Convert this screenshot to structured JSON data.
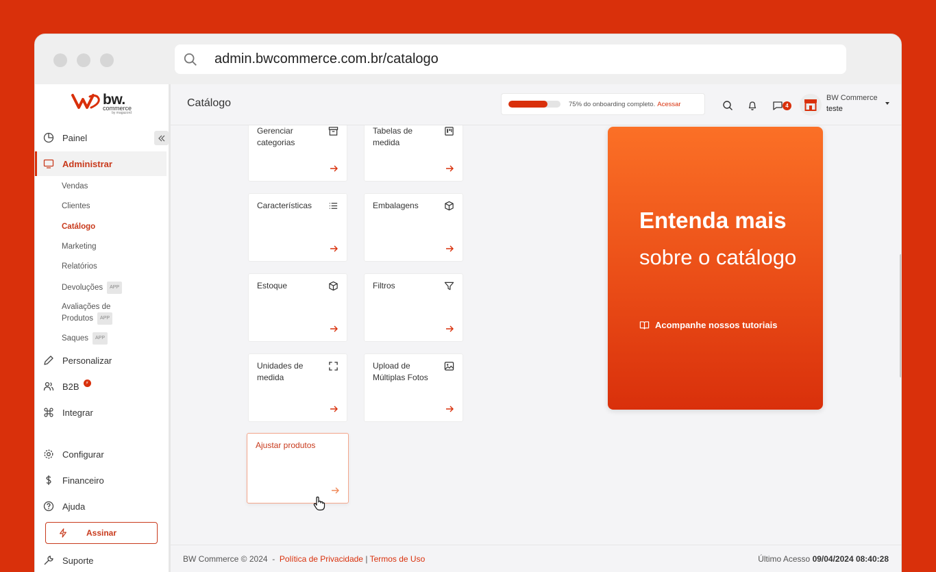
{
  "browser": {
    "url": "admin.bwcommerce.com.br/catalogo"
  },
  "logo": {
    "main": "bw.",
    "sub": "commerce",
    "tiny": "by magazord"
  },
  "sidebar": {
    "items": [
      {
        "label": "Painel"
      },
      {
        "label": "Administrar"
      },
      {
        "label": "Personalizar"
      },
      {
        "label": "B2B"
      },
      {
        "label": "Integrar"
      },
      {
        "label": "Configurar"
      },
      {
        "label": "Financeiro"
      },
      {
        "label": "Ajuda"
      },
      {
        "label": "Suporte"
      }
    ],
    "subitems": [
      {
        "label": "Vendas"
      },
      {
        "label": "Clientes"
      },
      {
        "label": "Catálogo"
      },
      {
        "label": "Marketing"
      },
      {
        "label": "Relatórios"
      },
      {
        "label": "Devoluções",
        "badge": "APP"
      },
      {
        "label": "Avaliações de Produtos",
        "badge": "APP"
      },
      {
        "label": "Saques",
        "badge": "APP"
      }
    ],
    "b2b_badge": "⚡",
    "assinar_label": "Assinar"
  },
  "header": {
    "title": "Catálogo",
    "onboarding_progress": 0.75,
    "onboarding_text": "75% do onboarding completo.",
    "onboarding_link": "Acessar",
    "messages_count": "4",
    "user_name": "BW Commerce",
    "user_sub": "teste"
  },
  "cards": [
    {
      "label": "Gerenciar categorias",
      "icon": "archive-icon"
    },
    {
      "label": "Tabelas de medida",
      "icon": "ruler-table-icon"
    },
    {
      "label": "Características",
      "icon": "list-icon"
    },
    {
      "label": "Embalagens",
      "icon": "box-icon"
    },
    {
      "label": "Estoque",
      "icon": "box-icon"
    },
    {
      "label": "Filtros",
      "icon": "filter-icon"
    },
    {
      "label": "Unidades de medida",
      "icon": "expand-icon"
    },
    {
      "label": "Upload de Múltiplas Fotos",
      "icon": "image-icon"
    },
    {
      "label": "Ajustar produtos",
      "icon": ""
    }
  ],
  "promo": {
    "title": "Entenda mais",
    "subtitle": "sobre o catálogo",
    "link": "Acompanhe nossos tutoriais"
  },
  "footer": {
    "copyright": "BW Commerce © 2024",
    "separator": "-",
    "privacy": "Política de Privacidade",
    "pipe": "|",
    "terms": "Termos de Uso",
    "last_access_label": "Último Acesso",
    "last_access_value": "09/04/2024 08:40:28"
  },
  "colors": {
    "brand": "#d9300b",
    "promo_top": "#fb7026",
    "promo_bottom": "#d9300b"
  }
}
